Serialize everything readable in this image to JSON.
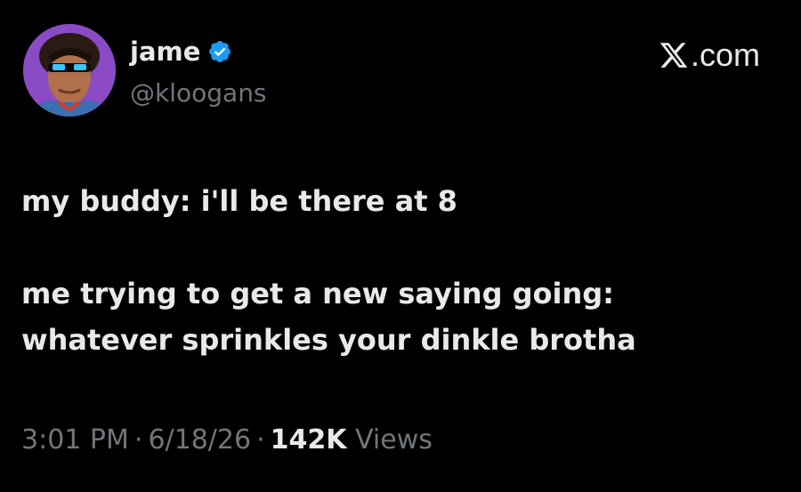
{
  "profile": {
    "display_name": "jame",
    "handle": "@kloogans",
    "verified": true,
    "verified_color": "#1d9bf0",
    "avatar_icon": "profile-photo"
  },
  "brand": {
    "label": ".com",
    "icon": "x-logo-icon"
  },
  "tweet": {
    "lines": [
      "my buddy: i'll be there at 8",
      "",
      "me trying to get a new saying going:",
      "whatever sprinkles your dinkle brotha"
    ]
  },
  "meta": {
    "time": "3:01 PM",
    "separator": "·",
    "date": "6/18/26",
    "views_count": "142K",
    "views_label": "Views"
  },
  "colors": {
    "background": "#000000",
    "primary_text": "#e7e9ea",
    "secondary_text": "#71767b"
  }
}
